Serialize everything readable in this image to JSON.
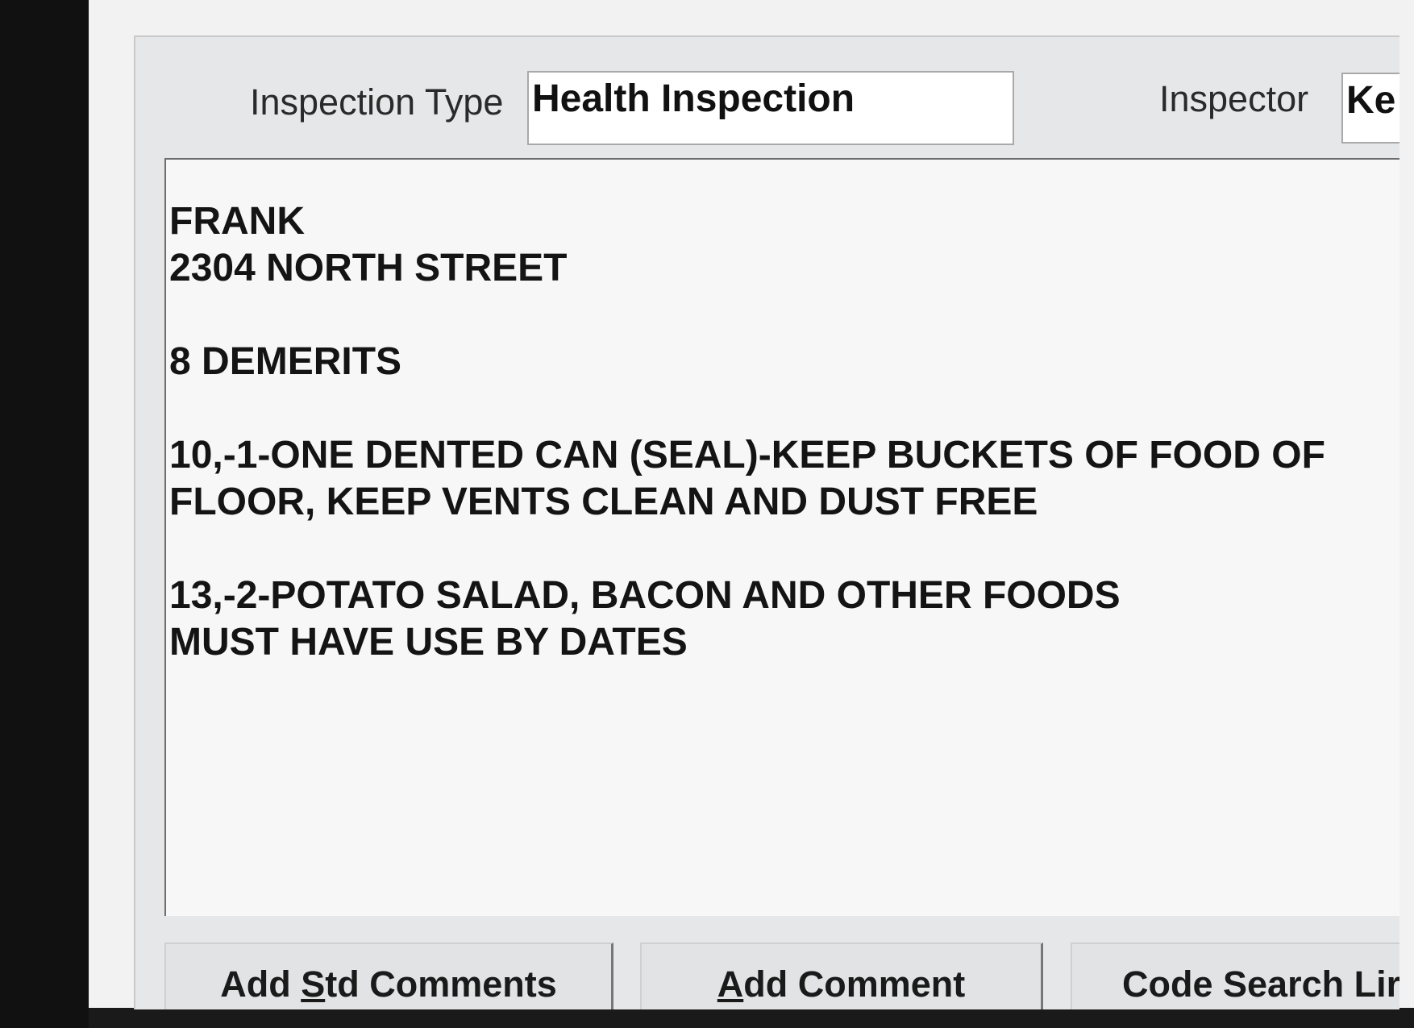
{
  "form": {
    "inspection_type_label": "Inspection Type",
    "inspection_type_value": "Health Inspection",
    "inspector_label": "Inspector",
    "inspector_value": "Ke"
  },
  "comments": {
    "lines": [
      "FRANK",
      "2304 NORTH STREET",
      "8 DEMERITS",
      "10,-1-ONE DENTED CAN (SEAL)-KEEP BUCKETS OF FOOD OF",
      "FLOOR, KEEP VENTS CLEAN AND DUST FREE",
      "13,-2-POTATO SALAD, BACON AND OTHER FOODS",
      "MUST HAVE USE BY DATES"
    ]
  },
  "buttons": {
    "std_comments": {
      "pre": "Add ",
      "accel": "S",
      "post": "td Comments"
    },
    "add_comment": {
      "pre": "",
      "accel": "A",
      "post": "dd Comment"
    },
    "code_search": {
      "label": "Code Search Lir"
    }
  }
}
